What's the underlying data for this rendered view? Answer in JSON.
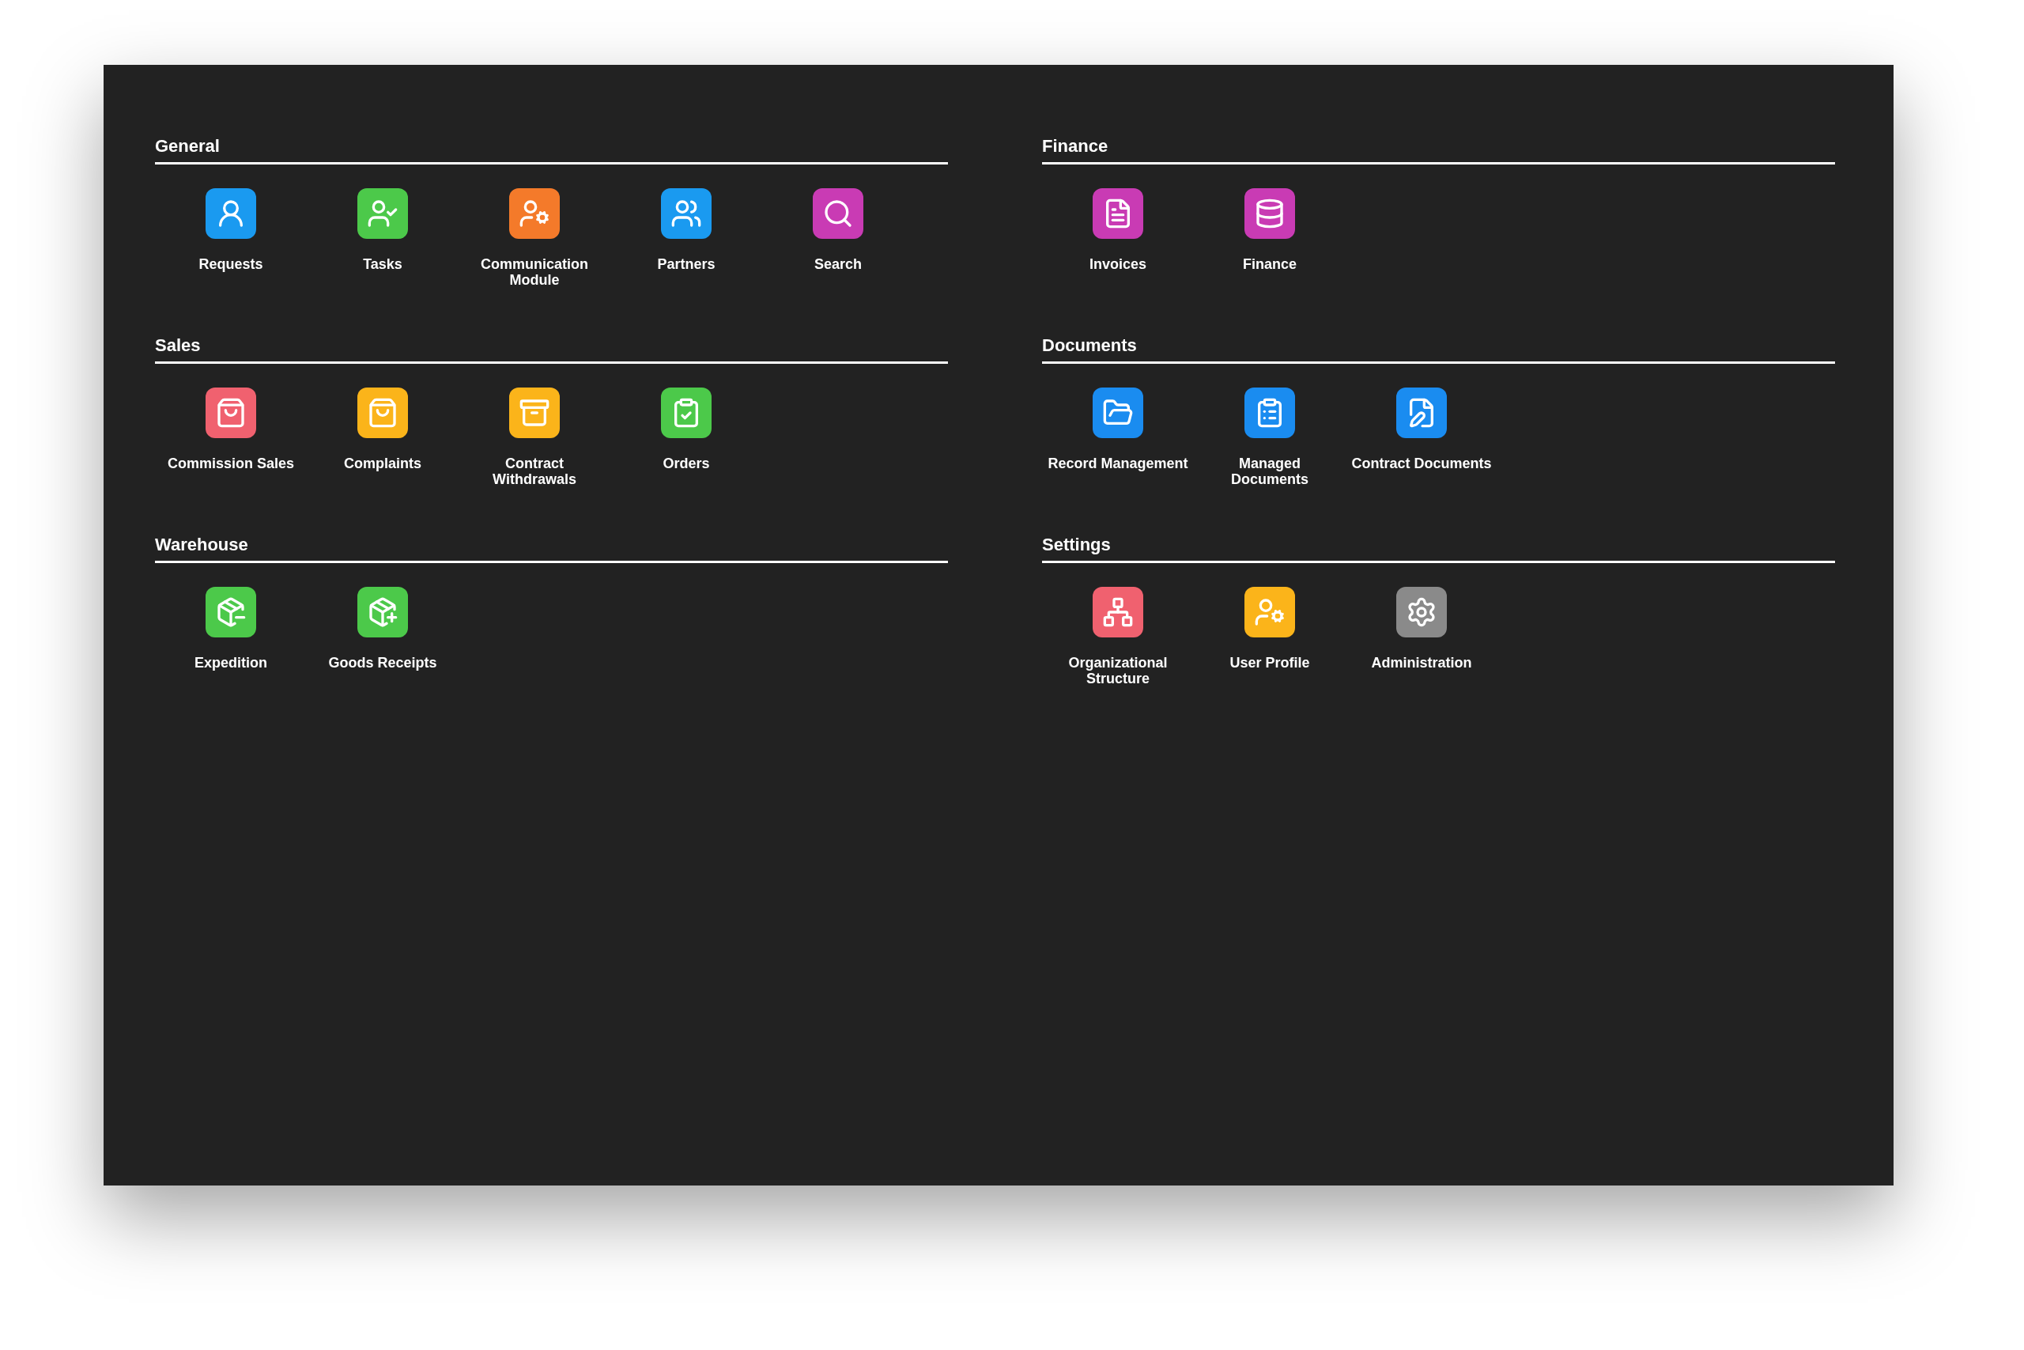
{
  "columns": [
    {
      "sections": [
        {
          "title": "General",
          "apps": [
            {
              "label": "Requests",
              "kind": "requests",
              "color": "#1a9af0"
            },
            {
              "label": "Tasks",
              "kind": "tasks",
              "color": "#4cc94a"
            },
            {
              "label": "Communication Module",
              "kind": "communication",
              "color": "#f47a2a"
            },
            {
              "label": "Partners",
              "kind": "partners",
              "color": "#1a9af0"
            },
            {
              "label": "Search",
              "kind": "search",
              "color": "#c93bb4"
            }
          ]
        },
        {
          "title": "Sales",
          "apps": [
            {
              "label": "Commission Sales",
              "kind": "commission",
              "color": "#f0616f"
            },
            {
              "label": "Complaints",
              "kind": "complaints",
              "color": "#fbb41a"
            },
            {
              "label": "Contract Withdrawals",
              "kind": "withdrawals",
              "color": "#fbb41a"
            },
            {
              "label": "Orders",
              "kind": "orders",
              "color": "#4cc94a"
            }
          ]
        },
        {
          "title": "Warehouse",
          "apps": [
            {
              "label": "Expedition",
              "kind": "expedition",
              "color": "#4cc94a"
            },
            {
              "label": "Goods Receipts",
              "kind": "receipts",
              "color": "#4cc94a"
            }
          ]
        }
      ]
    },
    {
      "sections": [
        {
          "title": "Finance",
          "apps": [
            {
              "label": "Invoices",
              "kind": "invoices",
              "color": "#c93bb4"
            },
            {
              "label": "Finance",
              "kind": "finance",
              "color": "#c93bb4"
            }
          ]
        },
        {
          "title": "Documents",
          "apps": [
            {
              "label": "Record Management",
              "kind": "records",
              "color": "#1a8cf0"
            },
            {
              "label": "Managed Documents",
              "kind": "managed",
              "color": "#1a8cf0"
            },
            {
              "label": "Contract Documents",
              "kind": "contracts",
              "color": "#1a8cf0"
            }
          ]
        },
        {
          "title": "Settings",
          "apps": [
            {
              "label": "Organizational Structure",
              "kind": "orgchart",
              "color": "#f0616f"
            },
            {
              "label": "User Profile",
              "kind": "profile",
              "color": "#fbb41a"
            },
            {
              "label": "Administration",
              "kind": "admin",
              "color": "#8a8a8a"
            }
          ]
        }
      ]
    }
  ]
}
